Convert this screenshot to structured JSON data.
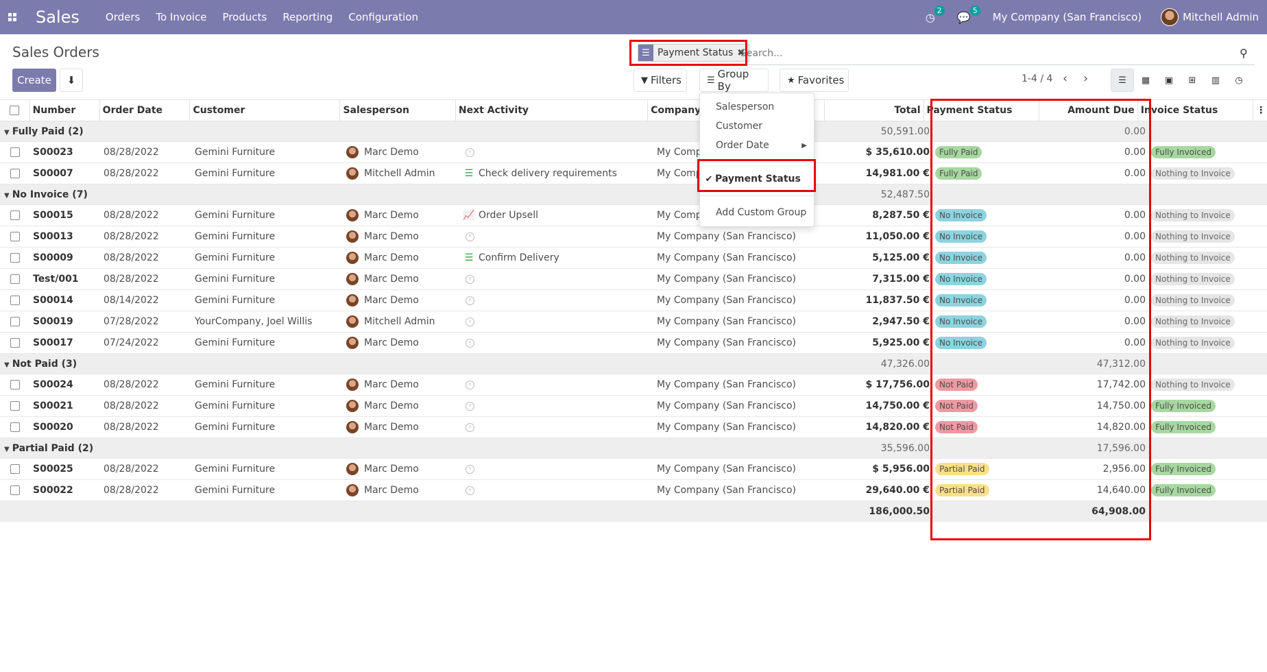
{
  "navbar": {
    "app_name": "Sales",
    "menu": [
      "Orders",
      "To Invoice",
      "Products",
      "Reporting",
      "Configuration"
    ],
    "activity_badge": "2",
    "messages_badge": "5",
    "company": "My Company (San Francisco)",
    "user": "Mitchell Admin",
    "background_color": "#7c7bad"
  },
  "control": {
    "breadcrumb": "Sales Orders",
    "create_label": "Create",
    "facet_label": "Payment Status",
    "search_placeholder": "Search...",
    "filters_label": "Filters",
    "groupby_label": "Group By",
    "favorites_label": "Favorites",
    "pager": "1-4 / 4"
  },
  "groupby_menu": {
    "items": [
      "Salesperson",
      "Customer",
      "Order Date"
    ],
    "selected": "Payment Status",
    "custom": "Add Custom Group"
  },
  "table": {
    "headers": [
      "Number",
      "Order Date",
      "Customer",
      "Salesperson",
      "Next Activity",
      "Company",
      "Total",
      "Payment Status",
      "Amount Due",
      "Invoice Status"
    ],
    "groups": [
      {
        "label": "Fully Paid (2)",
        "total": "50,591.00",
        "amount_due": "0.00",
        "rows": [
          {
            "number": "S00023",
            "date": "08/28/2022",
            "customer": "Gemini Furniture",
            "salesperson": "Marc Demo",
            "activity": "",
            "company": "My Company (San Francisco)",
            "total": "$ 35,610.00",
            "payment": "Fully Paid",
            "due": "0.00",
            "invoice": "Fully Invoiced"
          },
          {
            "number": "S00007",
            "date": "08/28/2022",
            "customer": "Gemini Furniture",
            "salesperson": "Mitchell Admin",
            "activity": "Check delivery requirements",
            "company": "My Company (San Francisco)",
            "total": "14,981.00 €",
            "payment": "Fully Paid",
            "due": "0.00",
            "invoice": "Nothing to Invoice"
          }
        ]
      },
      {
        "label": "No Invoice (7)",
        "total": "52,487.50",
        "amount_due": "",
        "rows": [
          {
            "number": "S00015",
            "date": "08/28/2022",
            "customer": "Gemini Furniture",
            "salesperson": "Marc Demo",
            "activity": "Order Upsell",
            "company": "My Company (San Francisco)",
            "total": "8,287.50 €",
            "payment": "No Invoice",
            "due": "0.00",
            "invoice": "Nothing to Invoice"
          },
          {
            "number": "S00013",
            "date": "08/28/2022",
            "customer": "Gemini Furniture",
            "salesperson": "Marc Demo",
            "activity": "",
            "company": "My Company (San Francisco)",
            "total": "11,050.00 €",
            "payment": "No Invoice",
            "due": "0.00",
            "invoice": "Nothing to Invoice"
          },
          {
            "number": "S00009",
            "date": "08/28/2022",
            "customer": "Gemini Furniture",
            "salesperson": "Marc Demo",
            "activity": "Confirm Delivery",
            "company": "My Company (San Francisco)",
            "total": "5,125.00 €",
            "payment": "No Invoice",
            "due": "0.00",
            "invoice": "Nothing to Invoice"
          },
          {
            "number": "Test/001",
            "date": "08/28/2022",
            "customer": "Gemini Furniture",
            "salesperson": "Marc Demo",
            "activity": "",
            "company": "My Company (San Francisco)",
            "total": "7,315.00 €",
            "payment": "No Invoice",
            "due": "0.00",
            "invoice": "Nothing to Invoice"
          },
          {
            "number": "S00014",
            "date": "08/14/2022",
            "customer": "Gemini Furniture",
            "salesperson": "Marc Demo",
            "activity": "",
            "company": "My Company (San Francisco)",
            "total": "11,837.50 €",
            "payment": "No Invoice",
            "due": "0.00",
            "invoice": "Nothing to Invoice"
          },
          {
            "number": "S00019",
            "date": "07/28/2022",
            "customer": "YourCompany, Joel Willis",
            "salesperson": "Mitchell Admin",
            "activity": "",
            "company": "My Company (San Francisco)",
            "total": "2,947.50 €",
            "payment": "No Invoice",
            "due": "0.00",
            "invoice": "Nothing to Invoice"
          },
          {
            "number": "S00017",
            "date": "07/24/2022",
            "customer": "Gemini Furniture",
            "salesperson": "Marc Demo",
            "activity": "",
            "company": "My Company (San Francisco)",
            "total": "5,925.00 €",
            "payment": "No Invoice",
            "due": "0.00",
            "invoice": "Nothing to Invoice"
          }
        ]
      },
      {
        "label": "Not Paid (3)",
        "total": "47,326.00",
        "amount_due": "47,312.00",
        "rows": [
          {
            "number": "S00024",
            "date": "08/28/2022",
            "customer": "Gemini Furniture",
            "salesperson": "Marc Demo",
            "activity": "",
            "company": "My Company (San Francisco)",
            "total": "$ 17,756.00",
            "payment": "Not Paid",
            "due": "17,742.00",
            "invoice": "Nothing to Invoice"
          },
          {
            "number": "S00021",
            "date": "08/28/2022",
            "customer": "Gemini Furniture",
            "salesperson": "Marc Demo",
            "activity": "",
            "company": "My Company (San Francisco)",
            "total": "14,750.00 €",
            "payment": "Not Paid",
            "due": "14,750.00",
            "invoice": "Fully Invoiced"
          },
          {
            "number": "S00020",
            "date": "08/28/2022",
            "customer": "Gemini Furniture",
            "salesperson": "Marc Demo",
            "activity": "",
            "company": "My Company (San Francisco)",
            "total": "14,820.00 €",
            "payment": "Not Paid",
            "due": "14,820.00",
            "invoice": "Fully Invoiced"
          }
        ]
      },
      {
        "label": "Partial Paid (2)",
        "total": "35,596.00",
        "amount_due": "17,596.00",
        "rows": [
          {
            "number": "S00025",
            "date": "08/28/2022",
            "customer": "Gemini Furniture",
            "salesperson": "Marc Demo",
            "activity": "",
            "company": "My Company (San Francisco)",
            "total": "$ 5,956.00",
            "payment": "Partial Paid",
            "due": "2,956.00",
            "invoice": "Fully Invoiced"
          },
          {
            "number": "S00022",
            "date": "08/28/2022",
            "customer": "Gemini Furniture",
            "salesperson": "Marc Demo",
            "activity": "",
            "company": "My Company (San Francisco)",
            "total": "29,640.00 €",
            "payment": "Partial Paid",
            "due": "14,640.00",
            "invoice": "Fully Invoiced"
          }
        ]
      }
    ],
    "footer_total": "186,000.50",
    "footer_due": "64,908.00"
  },
  "tag_colors": {
    "Fully Paid": "#a7d8a0",
    "No Invoice": "#8dd3e0",
    "Not Paid": "#ee9aa2",
    "Partial Paid": "#fbe08a",
    "Fully Invoiced": "#a7d8a0",
    "Nothing to Invoice": "#e6e6e6"
  },
  "activity_icons": {
    "Check delivery requirements": "list-icon",
    "Order Upsell": "chart-line-icon",
    "Confirm Delivery": "list-icon"
  },
  "highlight_color": "#e8000b"
}
